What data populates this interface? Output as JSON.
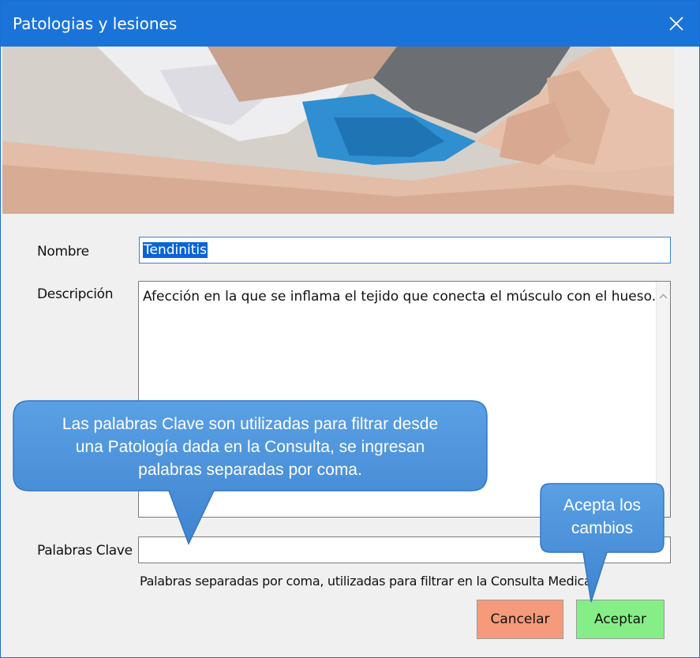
{
  "window": {
    "title": "Patologias y lesiones"
  },
  "form": {
    "nombre_label": "Nombre",
    "nombre_value": "Tendinitis",
    "descripcion_label": "Descripción",
    "descripcion_value": "Afección en la que se inflama el tejido que conecta el músculo con el hueso.",
    "palabras_label": "Palabras Clave",
    "palabras_value": "",
    "palabras_hint": "Palabras separadas por coma, utilizadas para filtrar en la Consulta Medica"
  },
  "buttons": {
    "cancel_label": "Cancelar",
    "accept_label": "Aceptar"
  },
  "callouts": {
    "keywords_line1": "Las palabras Clave son utilizadas para filtrar desde",
    "keywords_line2": "una Patología dada en la Consulta, se ingresan",
    "keywords_line3": "palabras separadas por coma.",
    "accept_line1": "Acepta los",
    "accept_line2": "cambios"
  },
  "colors": {
    "titlebar": "#1a73d9",
    "cancel_bg": "#f59a7a",
    "accept_bg": "#86ee86",
    "callout": "#4a90d9"
  }
}
